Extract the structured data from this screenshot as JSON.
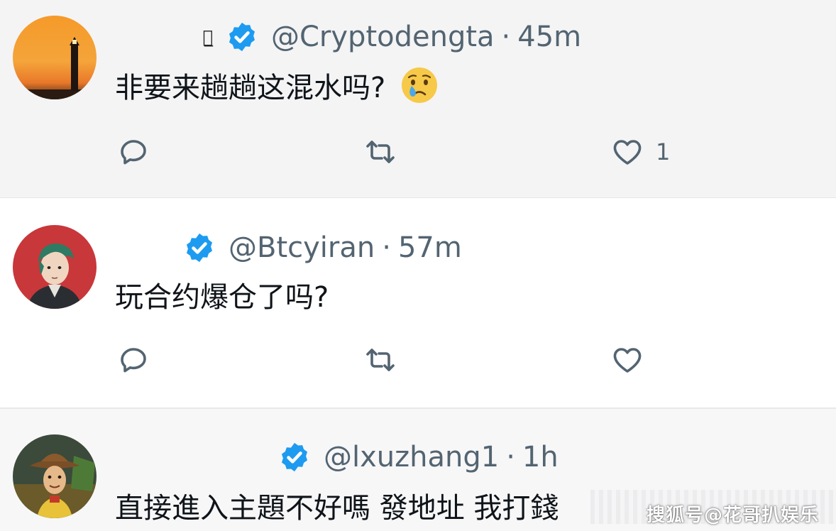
{
  "tweets": [
    {
      "handle": "@Cryptodengta",
      "separator": "·",
      "time": "45m",
      "text": "非要来趟趟这混水吗?",
      "emoji": "crying-face",
      "like_count": "1"
    },
    {
      "handle": "@Btcyiran",
      "separator": "·",
      "time": "57m",
      "text": "玩合约爆仓了吗?",
      "like_count": ""
    },
    {
      "handle": "@lxuzhang1",
      "separator": "·",
      "time": "1h",
      "text": "直接進入主題不好嗎 發地址 我打錢"
    }
  ],
  "watermark": "搜狐号@花哥扒娱乐",
  "colors": {
    "verified": "#1d9bf0",
    "muted_text": "#536471",
    "body_text": "#0f1419"
  }
}
